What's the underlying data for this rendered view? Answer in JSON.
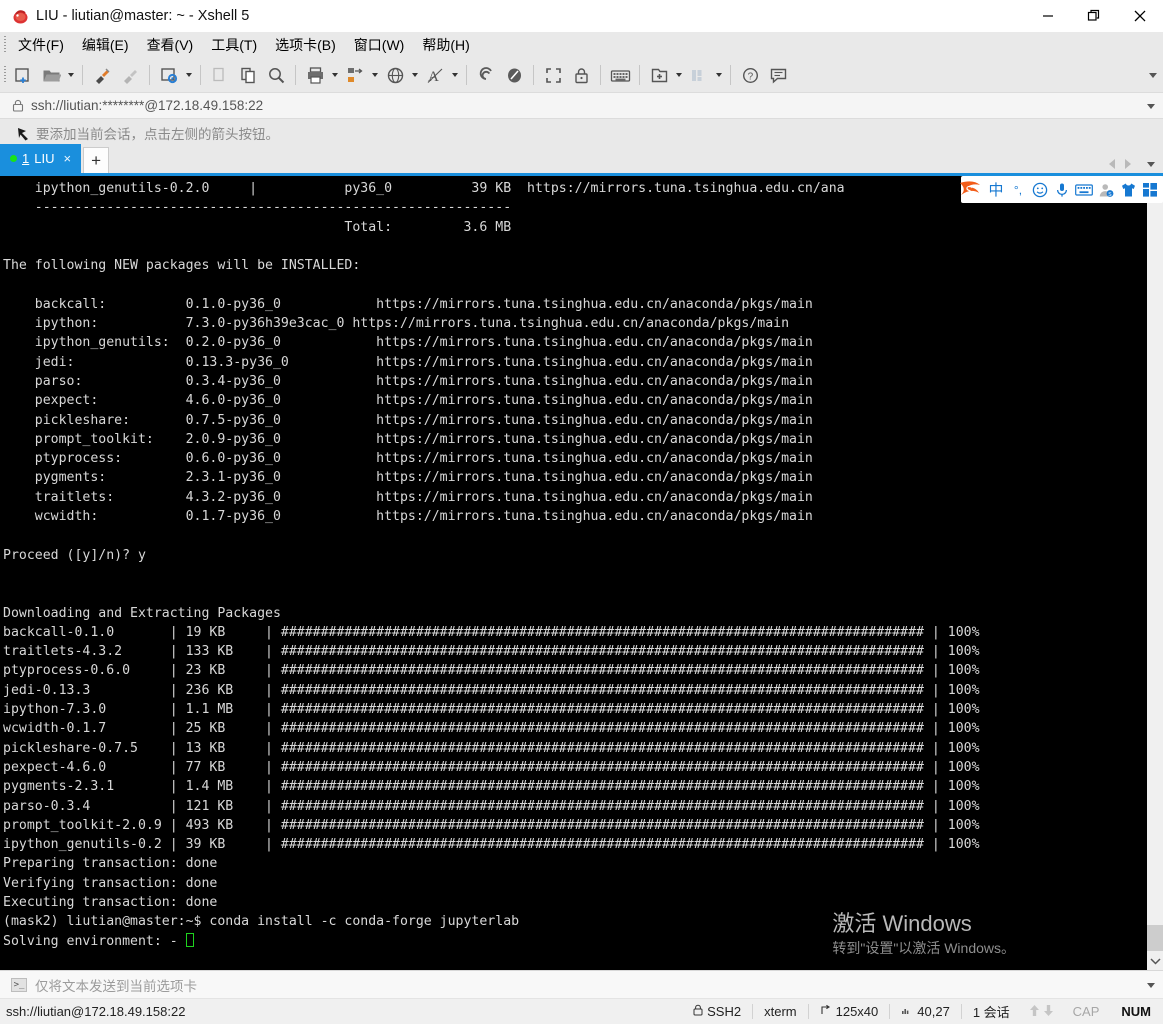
{
  "window": {
    "title": "LIU - liutian@master: ~ - Xshell 5",
    "app_icon": "xshell-logo-icon",
    "controls": {
      "minimize": "minimize-icon",
      "maximize": "maximize-icon",
      "close": "close-icon"
    }
  },
  "menubar": {
    "items": [
      {
        "label": "文件(F)",
        "name": "menu-file"
      },
      {
        "label": "编辑(E)",
        "name": "menu-edit"
      },
      {
        "label": "查看(V)",
        "name": "menu-view"
      },
      {
        "label": "工具(T)",
        "name": "menu-tools"
      },
      {
        "label": "选项卡(B)",
        "name": "menu-tabs"
      },
      {
        "label": "窗口(W)",
        "name": "menu-window"
      },
      {
        "label": "帮助(H)",
        "name": "menu-help"
      }
    ]
  },
  "toolbar": {
    "items": [
      "new-session-icon",
      "open-folder-icon",
      "separator",
      "connect-icon",
      "disconnect-icon",
      "separator",
      "session-properties-icon",
      "separator",
      "copy-disabled-icon",
      "paste-icon",
      "find-icon",
      "separator",
      "print-icon",
      "transfer-icon",
      "globe-icon",
      "font-icon",
      "separator",
      "ssh-tunnel-icon",
      "sftp-icon",
      "separator",
      "fullscreen-icon",
      "lock-icon",
      "separator",
      "keyboard-icon",
      "separator",
      "new-tab-icon",
      "layout-icon",
      "separator",
      "help-icon",
      "feedback-icon"
    ],
    "overflow": "toolbar-overflow-caret"
  },
  "address": {
    "value": "ssh://liutian:********@172.18.49.158:22",
    "lock_icon": "lock-icon",
    "dropdown": "address-dropdown-caret"
  },
  "hint": {
    "icon": "add-session-arrow-icon",
    "text": "要添加当前会话，点击左侧的箭头按钮。"
  },
  "tabs": {
    "items": [
      {
        "num": "1",
        "label": "LIU",
        "close": "×",
        "status_dot": "connected-dot-icon"
      }
    ],
    "add_label": "+",
    "nav": {
      "prev": "tab-prev-arrow-icon",
      "next": "tab-next-arrow-icon",
      "menu": "tab-list-caret-icon"
    }
  },
  "terminal": {
    "lines": [
      "    ipython_genutils-0.2.0     |           py36_0          39 KB  https://mirrors.tuna.tsinghua.edu.cn/ana",
      "    ------------------------------------------------------------",
      "                                           Total:         3.6 MB",
      "",
      "The following NEW packages will be INSTALLED:",
      "",
      "    backcall:          0.1.0-py36_0            https://mirrors.tuna.tsinghua.edu.cn/anaconda/pkgs/main",
      "    ipython:           7.3.0-py36h39e3cac_0 https://mirrors.tuna.tsinghua.edu.cn/anaconda/pkgs/main",
      "    ipython_genutils:  0.2.0-py36_0            https://mirrors.tuna.tsinghua.edu.cn/anaconda/pkgs/main",
      "    jedi:              0.13.3-py36_0           https://mirrors.tuna.tsinghua.edu.cn/anaconda/pkgs/main",
      "    parso:             0.3.4-py36_0            https://mirrors.tuna.tsinghua.edu.cn/anaconda/pkgs/main",
      "    pexpect:           4.6.0-py36_0            https://mirrors.tuna.tsinghua.edu.cn/anaconda/pkgs/main",
      "    pickleshare:       0.7.5-py36_0            https://mirrors.tuna.tsinghua.edu.cn/anaconda/pkgs/main",
      "    prompt_toolkit:    2.0.9-py36_0            https://mirrors.tuna.tsinghua.edu.cn/anaconda/pkgs/main",
      "    ptyprocess:        0.6.0-py36_0            https://mirrors.tuna.tsinghua.edu.cn/anaconda/pkgs/main",
      "    pygments:          2.3.1-py36_0            https://mirrors.tuna.tsinghua.edu.cn/anaconda/pkgs/main",
      "    traitlets:         4.3.2-py36_0            https://mirrors.tuna.tsinghua.edu.cn/anaconda/pkgs/main",
      "    wcwidth:           0.1.7-py36_0            https://mirrors.tuna.tsinghua.edu.cn/anaconda/pkgs/main",
      "",
      "Proceed ([y]/n)? y",
      "",
      "",
      "Downloading and Extracting Packages",
      "backcall-0.1.0       | 19 KB     | ################################################################################# | 100%",
      "traitlets-4.3.2      | 133 KB    | ################################################################################# | 100%",
      "ptyprocess-0.6.0     | 23 KB     | ################################################################################# | 100%",
      "jedi-0.13.3          | 236 KB    | ################################################################################# | 100%",
      "ipython-7.3.0        | 1.1 MB    | ################################################################################# | 100%",
      "wcwidth-0.1.7        | 25 KB     | ################################################################################# | 100%",
      "pickleshare-0.7.5    | 13 KB     | ################################################################################# | 100%",
      "pexpect-4.6.0        | 77 KB     | ################################################################################# | 100%",
      "pygments-2.3.1       | 1.4 MB    | ################################################################################# | 100%",
      "parso-0.3.4          | 121 KB    | ################################################################################# | 100%",
      "prompt_toolkit-2.0.9 | 493 KB    | ################################################################################# | 100%",
      "ipython_genutils-0.2 | 39 KB     | ################################################################################# | 100%",
      "Preparing transaction: done",
      "Verifying transaction: done",
      "Executing transaction: done",
      "(mask2) liutian@master:~$ conda install -c conda-forge jupyterlab"
    ],
    "last_line": "Solving environment: - ",
    "cursor": "block-cursor",
    "colors": {
      "background": "#000000",
      "foreground": "#d8d8d8",
      "cursor": "#1fd31f"
    }
  },
  "ime": {
    "items": [
      "sogou-logo-icon",
      "chinese-mode-icon",
      "punctuation-icon",
      "emoji-icon",
      "voice-input-icon",
      "soft-keyboard-icon",
      "user-account-icon",
      "skin-icon",
      "toolbox-icon"
    ],
    "chinese_glyph": "中",
    "punct_glyph": "°,"
  },
  "watermark": {
    "title": "激活 Windows",
    "subtitle": "转到\"设置\"以激活 Windows。"
  },
  "sendbar": {
    "icon": "command-prompt-icon",
    "text": "仅将文本发送到当前选项卡",
    "caret": "sendbar-caret-icon"
  },
  "statusbar": {
    "connection": "ssh://liutian@172.18.49.158:22",
    "protocol": "SSH2",
    "protocol_icon": "lock-icon",
    "terminal_type": "xterm",
    "size": "125x40",
    "size_icon": "resize-icon",
    "cursor_pos": "40,27",
    "cursor_icon": "position-icon",
    "sessions": "1 会话",
    "transfer_up": "upload-arrow-icon",
    "transfer_down": "download-arrow-icon",
    "cap": "CAP",
    "num": "NUM"
  },
  "scrollbar": {
    "thumb": "vscroll-thumb",
    "down_arrow": "vscroll-down-arrow-icon"
  },
  "colors": {
    "accent": "#1a8fdd",
    "ime_blue": "#1678d1",
    "terminal_bg": "#000000",
    "chrome_bg": "#e9e9e9"
  }
}
